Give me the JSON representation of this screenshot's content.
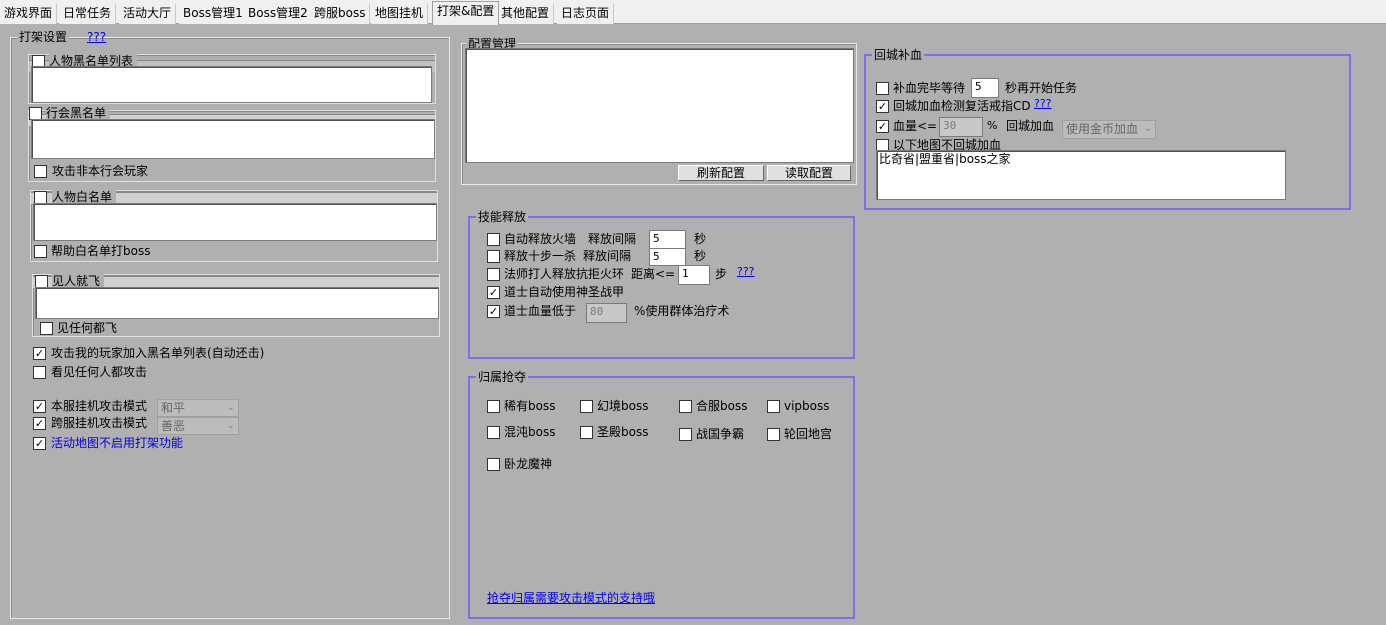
{
  "tabs": [
    "游戏界面",
    "日常任务",
    "活动大厅",
    "Boss管理1",
    "Boss管理2",
    "跨服boss",
    "地图挂机",
    "打架&配置",
    "其他配置",
    "日志页面"
  ],
  "fight": {
    "title": "打架设置",
    "help": "???",
    "player_blacklist": "人物黑名单列表",
    "guild_blacklist": "行会黑名单",
    "attack_non_guild": "攻击非本行会玩家",
    "player_whitelist": "人物白名单",
    "help_whitelist_boss": "帮助白名单打boss",
    "fly_on_sight": "见人就飞",
    "fly_on_any": "见任何都飞",
    "auto_blacklist_attackers": "攻击我的玩家加入黑名单列表(自动还击)",
    "attack_everyone": "看见任何人都攻击",
    "local_mode_label": "本服挂机攻击模式",
    "local_mode_value": "和平",
    "cross_mode_label": "跨服挂机攻击模式",
    "cross_mode_value": "善恶",
    "disable_in_event_maps": "活动地图不启用打架功能"
  },
  "config": {
    "title": "配置管理",
    "refresh_button": "刷新配置",
    "read_button": "读取配置"
  },
  "skills": {
    "title": "技能释放",
    "firewall": "自动释放火墙",
    "interval_label": "释放间隔",
    "firewall_interval": "5",
    "sec": "秒",
    "tenstep": "释放十步一杀",
    "tenstep_interval_label": "释放间隔",
    "tenstep_interval": "5",
    "mage_repel": "法师打人释放抗拒火环",
    "distance_label": "距离<=",
    "distance_value": "1",
    "step": "步",
    "help": "???",
    "taoist_armor": "道士自动使用神圣战甲",
    "taoist_hp_low": "道士血量低于",
    "taoist_hp_value": "80",
    "group_heal": "%使用群体治疗术"
  },
  "loot": {
    "title": "归属抢夺",
    "items": [
      "稀有boss",
      "幻境boss",
      "合服boss",
      "vipboss",
      "混沌boss",
      "圣殿boss",
      "战国争霸",
      "轮回地宫",
      "卧龙魔神"
    ],
    "note": "抢夺归属需要攻击模式的支持哦"
  },
  "heal": {
    "title": "回城补血",
    "wait_label": "补血完毕等待",
    "wait_value": "5",
    "wait_suffix": "秒再开始任务",
    "revive_ring": "回城加血检测复活戒指CD",
    "help": "???",
    "hp_label": "血量<=",
    "hp_value": "30",
    "percent": "%",
    "return_heal": "回城加血",
    "heal_method": "使用金币加血",
    "no_return_maps": "以下地图不回城加血",
    "maps_text": "比奇省|盟重省|boss之家"
  }
}
